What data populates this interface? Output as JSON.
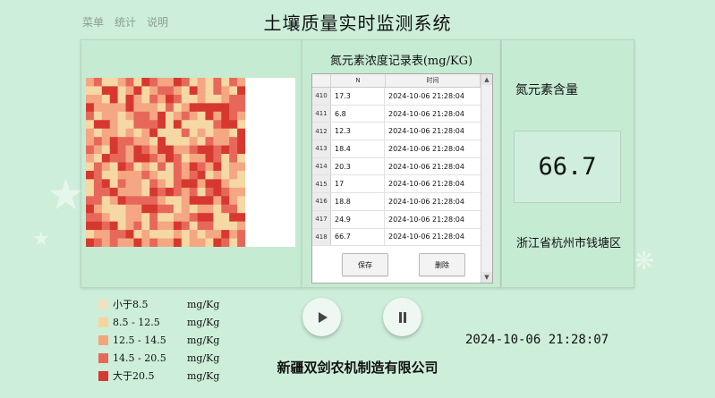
{
  "menu": [
    {
      "label": "菜单"
    },
    {
      "label": "统计"
    },
    {
      "label": "说明"
    }
  ],
  "title": "土壤质量实时监测系统",
  "heatmap": {
    "colors": [
      "#f6d8a4",
      "#f4a782",
      "#e7685a",
      "#d6382f"
    ],
    "rows": 20,
    "cols": 20
  },
  "table": {
    "title": "氮元素浓度记录表(mg/KG)",
    "columns": [
      "N",
      "时间"
    ],
    "rows": [
      {
        "index": "410",
        "n": "17.3",
        "time": "2024-10-06 21:28:04"
      },
      {
        "index": "411",
        "n": "6.8",
        "time": "2024-10-06 21:28:04"
      },
      {
        "index": "412",
        "n": "12.3",
        "time": "2024-10-06 21:28:04"
      },
      {
        "index": "413",
        "n": "18.4",
        "time": "2024-10-06 21:28:04"
      },
      {
        "index": "414",
        "n": "20.3",
        "time": "2024-10-06 21:28:04"
      },
      {
        "index": "415",
        "n": "17",
        "time": "2024-10-06 21:28:04"
      },
      {
        "index": "416",
        "n": "18.8",
        "time": "2024-10-06 21:28:04"
      },
      {
        "index": "417",
        "n": "24.9",
        "time": "2024-10-06 21:28:04"
      },
      {
        "index": "418",
        "n": "66.7",
        "time": "2024-10-06 21:28:04"
      }
    ],
    "save_label": "保存",
    "delete_label": "删除"
  },
  "info": {
    "label": "氮元素含量",
    "value": "66.7",
    "location": "浙江省杭州市钱塘区"
  },
  "legend": [
    {
      "range": "小于8.5",
      "unit": "mg/Kg",
      "color": "#f1e2c3"
    },
    {
      "range": "8.5 - 12.5",
      "unit": "mg/Kg",
      "color": "#f6d59c"
    },
    {
      "range": "12.5 - 14.5",
      "unit": "mg/Kg",
      "color": "#f5a57c"
    },
    {
      "range": "14.5 - 20.5",
      "unit": "mg/Kg",
      "color": "#e7685a"
    },
    {
      "range": "大于20.5",
      "unit": "mg/Kg",
      "color": "#d43a31"
    }
  ],
  "controls": {
    "play_icon": "play-icon",
    "pause_icon": "pause-icon"
  },
  "datetime": "2024-10-06 21:28:07",
  "company": "新疆双剑农机制造有限公司"
}
